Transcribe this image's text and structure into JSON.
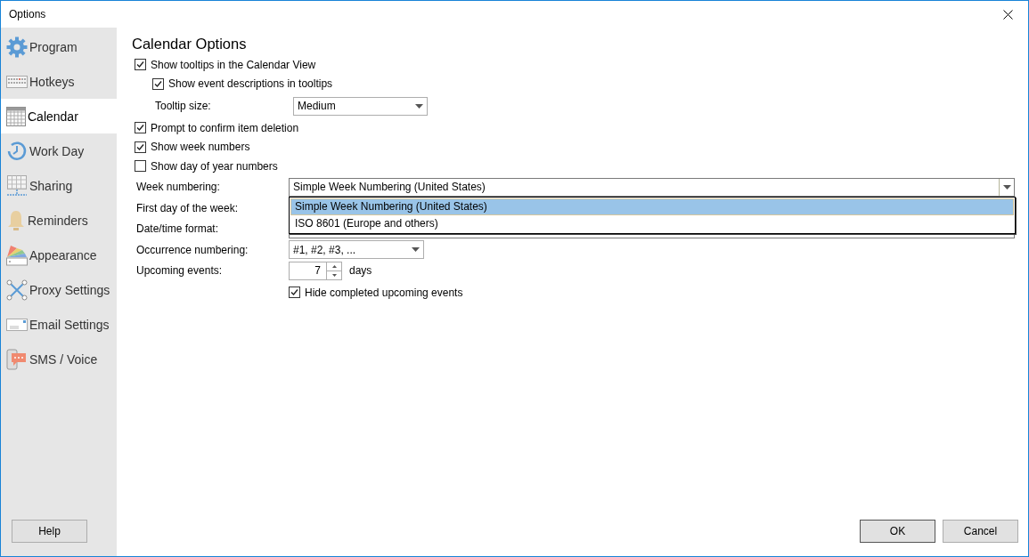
{
  "window": {
    "title": "Options"
  },
  "sidebar": {
    "items": [
      {
        "label": "Program",
        "selected": false
      },
      {
        "label": "Hotkeys",
        "selected": false
      },
      {
        "label": "Calendar",
        "selected": true
      },
      {
        "label": "Work Day",
        "selected": false
      },
      {
        "label": "Sharing",
        "selected": false
      },
      {
        "label": "Reminders",
        "selected": false
      },
      {
        "label": "Appearance",
        "selected": false
      },
      {
        "label": "Proxy Settings",
        "selected": false
      },
      {
        "label": "Email Settings",
        "selected": false
      },
      {
        "label": "SMS / Voice",
        "selected": false
      }
    ]
  },
  "calendar_options": {
    "title": "Calendar Options",
    "show_tooltips": {
      "label": "Show tooltips in the Calendar View",
      "checked": true
    },
    "show_descriptions": {
      "label": "Show event descriptions in tooltips",
      "checked": true
    },
    "tooltip_size": {
      "label": "Tooltip size:",
      "value": "Medium"
    },
    "prompt_delete": {
      "label": "Prompt to confirm item deletion",
      "checked": true
    },
    "week_numbers": {
      "label": "Show week numbers",
      "checked": true
    },
    "day_of_year": {
      "label": "Show day of year numbers",
      "checked": false
    },
    "week_numbering": {
      "label": "Week numbering:",
      "value": "Simple Week Numbering (United States)",
      "expanded": true,
      "options": [
        {
          "label": "Simple Week Numbering (United States)",
          "selected": true
        },
        {
          "label": "ISO 8601 (Europe and others)",
          "selected": false
        }
      ]
    },
    "first_day": {
      "label": "First day of the week:"
    },
    "date_format": {
      "label": "Date/time format:"
    },
    "occurrence_numbering": {
      "label": "Occurrence numbering:",
      "value": "#1, #2, #3, ..."
    },
    "upcoming_events": {
      "label": "Upcoming events:",
      "value": "7",
      "unit": "days"
    },
    "hide_completed": {
      "label": "Hide completed upcoming events",
      "checked": true
    }
  },
  "buttons": [
    {
      "label": "Help",
      "default": false
    },
    {
      "label": "OK",
      "default": true
    },
    {
      "label": "Cancel",
      "default": false
    }
  ]
}
